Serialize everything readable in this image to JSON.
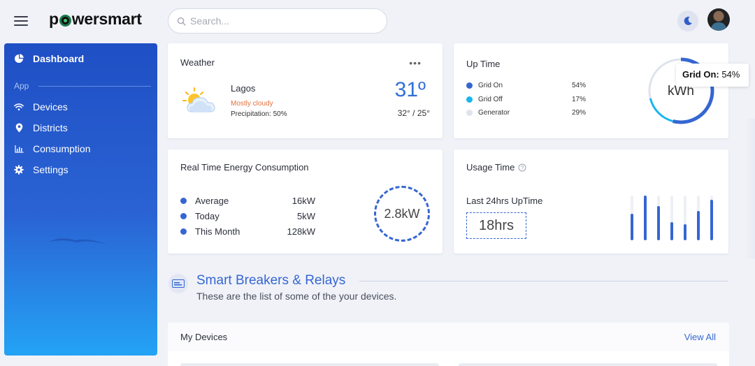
{
  "header": {
    "logo": "powersmart",
    "search_placeholder": "Search...",
    "theme_icon": "moon-icon",
    "menu_icon": "hamburger-icon"
  },
  "sidebar": {
    "section_label": "App",
    "items": [
      {
        "label": "Dashboard",
        "icon": "pie-chart-icon"
      },
      {
        "label": "Devices",
        "icon": "wifi-icon"
      },
      {
        "label": "Districts",
        "icon": "location-pin-icon"
      },
      {
        "label": "Consumption",
        "icon": "bar-chart-icon"
      },
      {
        "label": "Settings",
        "icon": "gear-icon"
      }
    ]
  },
  "weather": {
    "title": "Weather",
    "menu": "•••",
    "city": "Lagos",
    "condition": "Mostly cloudy",
    "precipitation": "Precipitation: 50%",
    "temperature": "31º",
    "range": "32° / 25°"
  },
  "uptime": {
    "title": "Up Time",
    "center_label": "kWh",
    "legend": [
      {
        "label": "Grid On",
        "value": "54%",
        "color": "#3566d2",
        "fraction": 0.54
      },
      {
        "label": "Grid Off",
        "value": "17%",
        "color": "#19b6ee",
        "fraction": 0.17
      },
      {
        "label": "Generator",
        "value": "29%",
        "color": "#dfe3ec",
        "fraction": 0.29
      }
    ],
    "tooltip_label": "Grid On:",
    "tooltip_value": "54%"
  },
  "realtime": {
    "title": "Real Time Energy Consumption",
    "rows": [
      {
        "label": "Average",
        "value": "16kW"
      },
      {
        "label": "Today",
        "value": "5kW"
      },
      {
        "label": "This Month",
        "value": "128kW"
      }
    ],
    "current": "2.8kW"
  },
  "usage": {
    "title": "Usage Time",
    "info_icon": "help-circle-icon",
    "subtitle": "Last 24hrs UpTime",
    "value": "18hrs",
    "bars": [
      0.6,
      1.0,
      0.76,
      0.4,
      0.36,
      0.66,
      0.9
    ]
  },
  "section": {
    "icon": "breaker-icon",
    "title": "Smart Breakers & Relays",
    "subtitle": "These are the list of some of the your devices."
  },
  "devices": {
    "title": "My Devices",
    "view_all": "View All"
  }
}
